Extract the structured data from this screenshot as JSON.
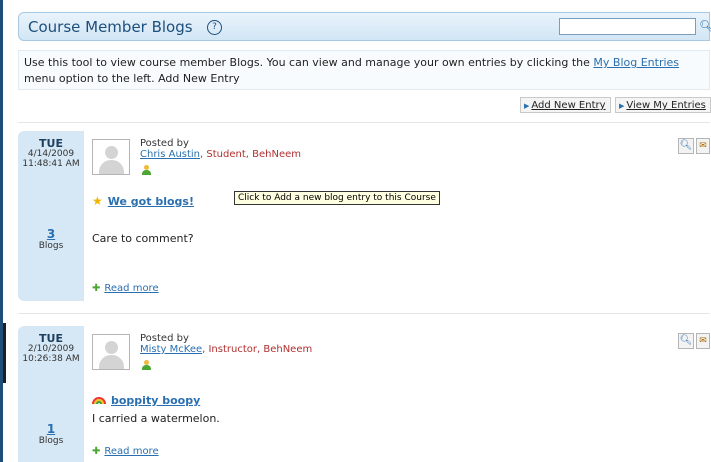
{
  "header": {
    "title": "Course Member Blogs",
    "help_glyph": "?"
  },
  "intro": {
    "text_before": "Use this tool to view course member Blogs. You can view and manage your own entries by clicking the ",
    "link": "My Blog Entries",
    "text_after": " menu option to the left. Add New Entry"
  },
  "actions": {
    "add_label": "Add New Entry",
    "view_label": "View My Entries"
  },
  "tooltip": "Click to Add a new blog entry to this Course",
  "entries": [
    {
      "dow": "TUE",
      "date": "4/14/2009",
      "time": "11:48:41 AM",
      "count": "3",
      "count_label": "Blogs",
      "posted_by": "Posted by",
      "author": "Chris Austin",
      "role": ", Student, BehNeem",
      "title": "We got blogs!",
      "title_icon": "star-icon",
      "body": "Care to comment?",
      "read_more": "Read more"
    },
    {
      "dow": "TUE",
      "date": "2/10/2009",
      "time": "10:26:38 AM",
      "count": "1",
      "count_label": "Blogs",
      "posted_by": "Posted by",
      "author": "Misty McKee",
      "role": ", Instructor, BehNeem",
      "title": "boppity boopy",
      "title_icon": "rainbow-icon",
      "body": "I carried a watermelon.",
      "read_more": "Read more"
    }
  ]
}
